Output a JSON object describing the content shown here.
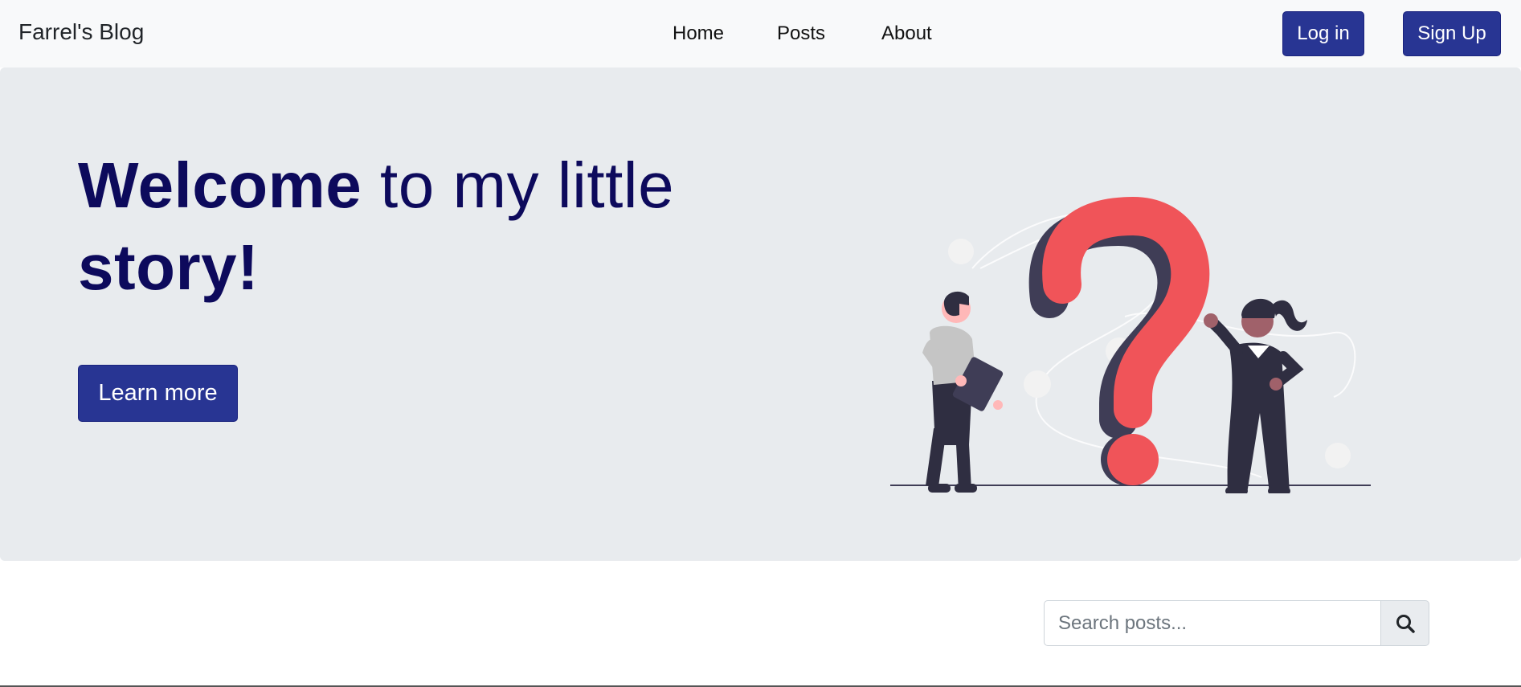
{
  "navbar": {
    "brand": "Farrel's Blog",
    "links": [
      "Home",
      "Posts",
      "About"
    ],
    "login_label": "Log in",
    "signup_label": "Sign Up"
  },
  "hero": {
    "title_bold_1": "Welcome",
    "title_regular": " to my little ",
    "title_bold_2": "story!",
    "button_label": "Learn more",
    "illustration": "question-mark-people-illustration"
  },
  "search": {
    "placeholder": "Search posts...",
    "value": "",
    "icon": "search-icon"
  },
  "colors": {
    "primary": "#283593",
    "heading": "#0d0a5c",
    "hero_bg": "#e8ebee",
    "navbar_bg": "#f8f9fa",
    "accent": "#f05459"
  }
}
